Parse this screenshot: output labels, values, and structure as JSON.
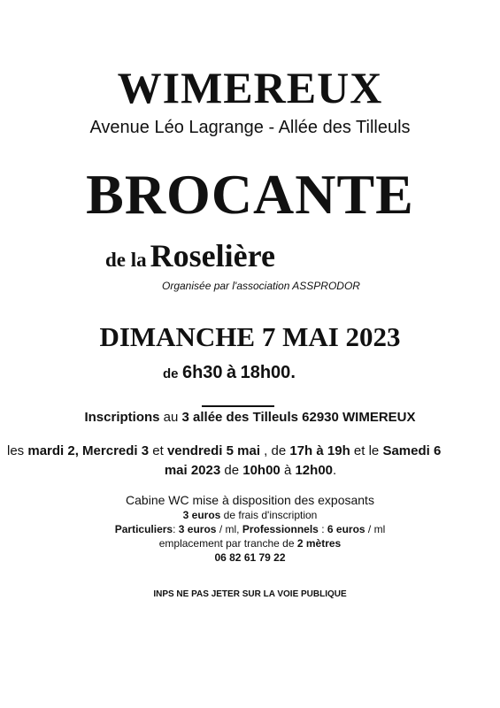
{
  "poster": {
    "town": "WIMEREUX",
    "street": "Avenue Léo Lagrange - Allée des Tilleuls",
    "event": "BROCANTE",
    "subtitle_small": "de la",
    "subtitle_big": "Roselière",
    "organizer": "Organisée par l'association ASSPRODOR",
    "date": "DIMANCHE 7 MAI 2023",
    "hours": {
      "de": "de",
      "start": "6h30",
      "a": "à",
      "end": "18h00",
      "dot": "."
    },
    "inscriptions": {
      "label": "Inscriptions",
      "au": "au",
      "address": "3 allée des Tilleuls 62930 WIMEREUX"
    },
    "days": {
      "les": "les",
      "d1": "mardi 2, Mercredi 3",
      "et": "et",
      "d2": "vendredi 5 mai",
      "sep": ", de",
      "t1": "17h à 19h",
      "etle": "et le",
      "d3": "Samedi 6",
      "d3b": "mai 2023",
      "de": "de",
      "t2": "10h00",
      "a": "à",
      "t3": "12h00",
      "end": "."
    },
    "cabine": "Cabine WC mise à disposition des exposants",
    "frais": {
      "amount": "3 euros",
      "rest": "de frais d'inscription"
    },
    "tarifs": {
      "p1": "Particuliers",
      "sep1": ": ",
      "v1": "3 euros",
      "u1": "/ ml,",
      "p2": "Professionnels",
      "sep2": ":",
      "v2": "6 euros",
      "u2": "/ ml"
    },
    "emplacement": {
      "text": "emplacement par tranche de",
      "size": "2 mètres"
    },
    "phone": "06 82 61 79 22",
    "notice": "INPS NE PAS JETER SUR LA VOIE PUBLIQUE"
  }
}
